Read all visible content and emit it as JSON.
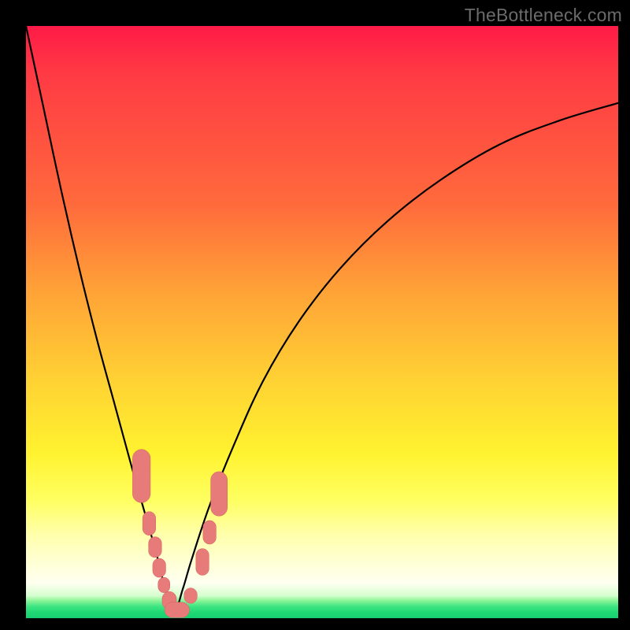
{
  "watermark": "TheBottleneck.com",
  "colors": {
    "curve": "#000000",
    "marker_fill": "#e77b7a",
    "marker_stroke": "#d55f5f",
    "background_black": "#000000"
  },
  "chart_data": {
    "type": "line",
    "title": "",
    "xlabel": "",
    "ylabel": "",
    "xlim": [
      0,
      100
    ],
    "ylim": [
      0,
      100
    ],
    "grid": false,
    "legend": false,
    "series": [
      {
        "name": "bottleneck-curve",
        "comment": "x in 0..100, y is visual height 0..100 (0 = bottom green, 100 = top red). V-shaped curve, minimum near x≈25.",
        "x": [
          0,
          3,
          6,
          9,
          12,
          15,
          18,
          20,
          22,
          23.5,
          25,
          26.5,
          28,
          31,
          35,
          40,
          46,
          53,
          61,
          70,
          80,
          90,
          100
        ],
        "y": [
          100,
          86,
          72,
          59,
          47,
          36,
          25,
          18,
          11,
          5,
          1,
          5,
          10,
          19,
          29,
          40,
          50,
          59,
          67,
          74,
          80,
          84,
          87
        ]
      }
    ],
    "markers": {
      "comment": "Rounded-rect pink markers clustered near the bottom of the V, on both arms.",
      "points": [
        {
          "x": 19.5,
          "y": 24,
          "w": 3.0,
          "h": 9
        },
        {
          "x": 20.8,
          "y": 16,
          "w": 2.2,
          "h": 4
        },
        {
          "x": 21.8,
          "y": 12,
          "w": 2.2,
          "h": 3.5
        },
        {
          "x": 22.5,
          "y": 8.5,
          "w": 2.2,
          "h": 3.2
        },
        {
          "x": 23.3,
          "y": 5.6,
          "w": 2.0,
          "h": 2.6
        },
        {
          "x": 24.2,
          "y": 3.0,
          "w": 2.4,
          "h": 3.0
        },
        {
          "x": 25.5,
          "y": 1.4,
          "w": 4.2,
          "h": 2.6
        },
        {
          "x": 27.8,
          "y": 3.8,
          "w": 2.2,
          "h": 2.6
        },
        {
          "x": 29.8,
          "y": 9.5,
          "w": 2.2,
          "h": 4.5
        },
        {
          "x": 31.0,
          "y": 14.5,
          "w": 2.2,
          "h": 4.0
        },
        {
          "x": 32.6,
          "y": 21.0,
          "w": 2.8,
          "h": 7.5
        }
      ]
    },
    "gradient_bands": [
      {
        "label": "red",
        "approx_y_range": [
          70,
          100
        ]
      },
      {
        "label": "orange",
        "approx_y_range": [
          40,
          70
        ]
      },
      {
        "label": "yellow",
        "approx_y_range": [
          8,
          40
        ]
      },
      {
        "label": "pale",
        "approx_y_range": [
          3,
          8
        ]
      },
      {
        "label": "green",
        "approx_y_range": [
          0,
          3
        ]
      }
    ]
  }
}
